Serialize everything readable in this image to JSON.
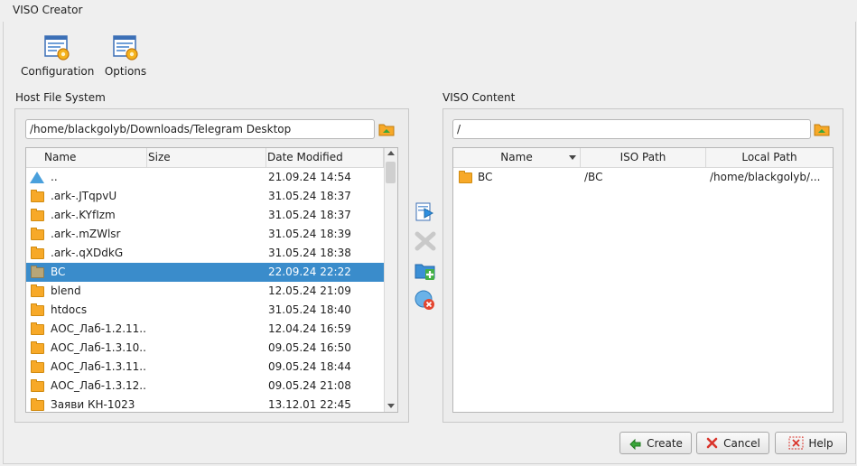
{
  "window": {
    "title": "VISO Creator"
  },
  "toolbar": {
    "configuration_label": "Configuration",
    "options_label": "Options"
  },
  "host": {
    "label": "Host File System",
    "path": "/home/blackgolyb/Downloads/Telegram Desktop",
    "columns": [
      "Name",
      "Size",
      "Date Modified"
    ],
    "rows": [
      {
        "name": "..",
        "size": "",
        "date": "21.09.24 14:54",
        "icon": "up-arrow-icon"
      },
      {
        "name": ".ark-.JTqpvU",
        "size": "",
        "date": "31.05.24 18:37",
        "icon": "folder-icon"
      },
      {
        "name": ".ark-.KYfIzm",
        "size": "",
        "date": "31.05.24 18:37",
        "icon": "folder-icon"
      },
      {
        "name": ".ark-.mZWlsr",
        "size": "",
        "date": "31.05.24 18:39",
        "icon": "folder-icon"
      },
      {
        "name": ".ark-.qXDdkG",
        "size": "",
        "date": "31.05.24 18:38",
        "icon": "folder-icon"
      },
      {
        "name": "BC",
        "size": "",
        "date": "22.09.24 22:22",
        "icon": "folder-icon",
        "selected": true
      },
      {
        "name": "blend",
        "size": "",
        "date": "12.05.24 21:09",
        "icon": "folder-icon"
      },
      {
        "name": "htdocs",
        "size": "",
        "date": "31.05.24 18:40",
        "icon": "folder-icon"
      },
      {
        "name": "АОС_Лаб-1.2.11...",
        "size": "",
        "date": "12.04.24 16:59",
        "icon": "folder-icon"
      },
      {
        "name": "АОС_Лаб-1.3.10...",
        "size": "",
        "date": "09.05.24 16:50",
        "icon": "folder-icon"
      },
      {
        "name": "АОС_Лаб-1.3.11...",
        "size": "",
        "date": "09.05.24 18:44",
        "icon": "folder-icon"
      },
      {
        "name": "АОС_Лаб-1.3.12...",
        "size": "",
        "date": "09.05.24 21:08",
        "icon": "folder-icon"
      },
      {
        "name": "Заяви КН-1023",
        "size": "",
        "date": "13.12.01 22:45",
        "icon": "folder-icon"
      }
    ]
  },
  "viso": {
    "label": "VISO Content",
    "path": "/",
    "columns": [
      "Name",
      "ISO Path",
      "Local Path"
    ],
    "rows": [
      {
        "name": "BC",
        "iso_path": "/BC",
        "local_path": "/home/blackgolyb/..."
      }
    ]
  },
  "buttons": {
    "create": "Create",
    "cancel": "Cancel",
    "help": "Help"
  },
  "colors": {
    "selection": "#3a8ccb",
    "folder": "#f7a928",
    "accent_green": "#3aa63a",
    "accent_red": "#d9342b"
  }
}
